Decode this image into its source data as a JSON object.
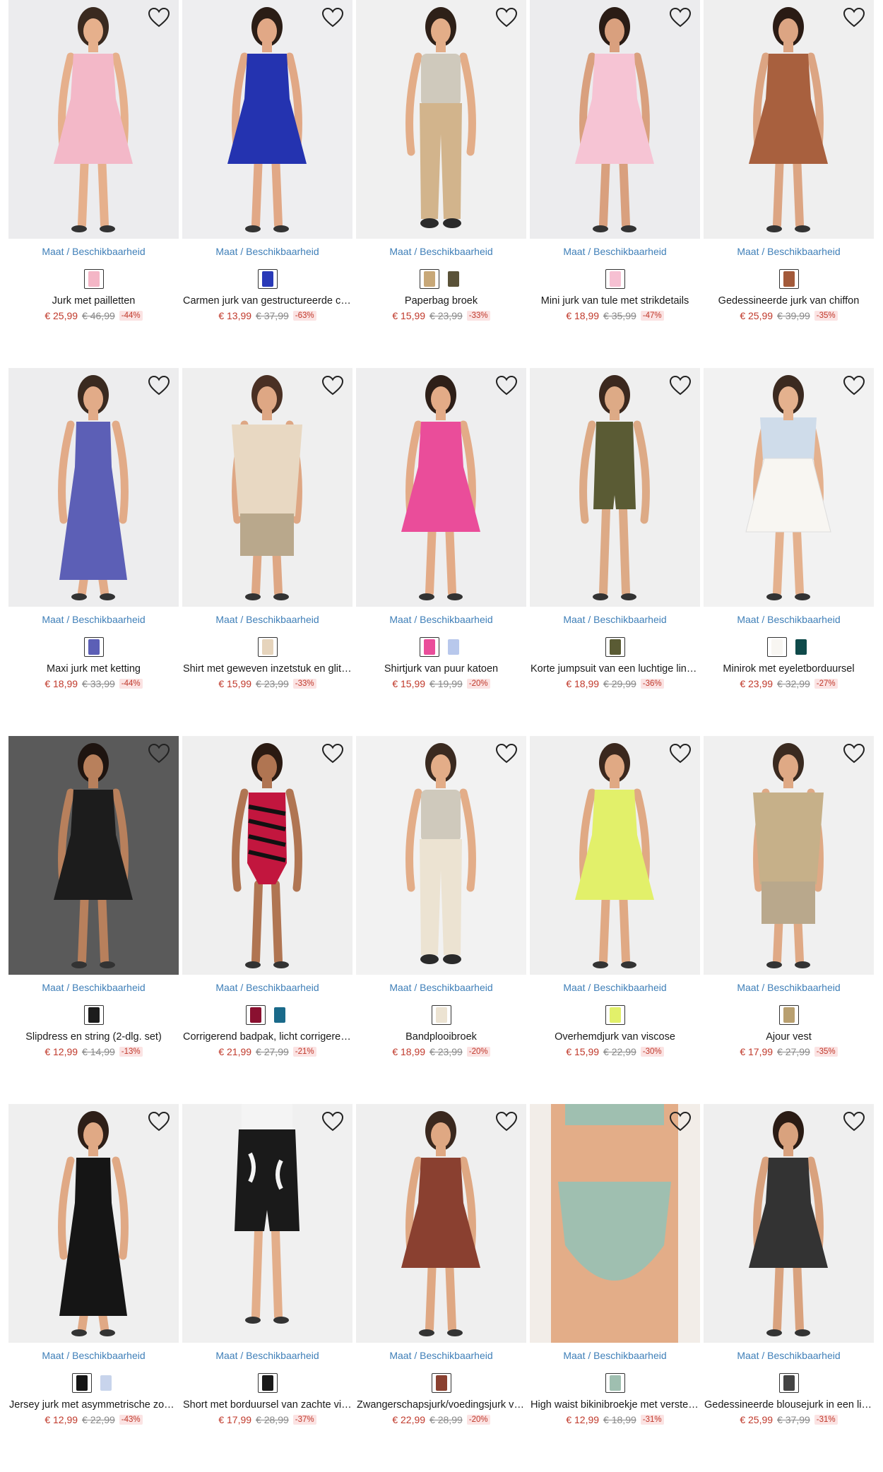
{
  "availability_label": "Maat / Beschikbaarheid",
  "products": [
    {
      "name": "Jurk met pailletten",
      "price": "€ 25,99",
      "old_price": "€ 46,99",
      "discount": "-44%",
      "bg": "#ececee",
      "garment": "#f3b8c8",
      "skin": "#e6b08c",
      "hair": "#3a2a20",
      "shape": "dress",
      "swatches": [
        "#f4b6c6"
      ]
    },
    {
      "name": "Carmen jurk van gestructureerde crêpe",
      "price": "€ 13,99",
      "old_price": "€ 37,99",
      "discount": "-63%",
      "bg": "#eeeef0",
      "garment": "#2433b0",
      "skin": "#e1a886",
      "hair": "#2b1d16",
      "shape": "dress",
      "swatches": [
        "#2a3ab8"
      ]
    },
    {
      "name": "Paperbag broek",
      "price": "€ 15,99",
      "old_price": "€ 23,99",
      "discount": "-33%",
      "bg": "#f0f0f0",
      "garment": "#d2b48c",
      "skin": "#e3ad88",
      "hair": "#2e2018",
      "shape": "pants",
      "swatches": [
        "#c8a878",
        "#5a5238"
      ]
    },
    {
      "name": "Mini jurk van tule met strikdetails",
      "price": "€ 18,99",
      "old_price": "€ 35,99",
      "discount": "-47%",
      "bg": "#ececee",
      "garment": "#f6c4d4",
      "skin": "#d9a07e",
      "hair": "#2a1c15",
      "shape": "dress",
      "swatches": [
        "#f6c0d2"
      ]
    },
    {
      "name": "Gedessineerde jurk van chiffon",
      "price": "€ 25,99",
      "old_price": "€ 39,99",
      "discount": "-35%",
      "bg": "#efefef",
      "garment": "#a8603e",
      "skin": "#dca583",
      "hair": "#2a1b14",
      "shape": "dress",
      "swatches": [
        "#a35a3a"
      ]
    },
    {
      "name": "Maxi jurk met ketting",
      "price": "€ 18,99",
      "old_price": "€ 33,99",
      "discount": "-44%",
      "bg": "#ededee",
      "garment": "#5c5fb6",
      "skin": "#e2ab88",
      "hair": "#3a2a20",
      "shape": "maxi",
      "swatches": [
        "#5c5fb6"
      ]
    },
    {
      "name": "Shirt met geweven inzetstuk en glitter",
      "price": "€ 15,99",
      "old_price": "€ 23,99",
      "discount": "-33%",
      "bg": "#efefef",
      "garment": "#e8d8c2",
      "skin": "#dea784",
      "hair": "#4a3024",
      "shape": "top",
      "swatches": [
        "#e6d4bc"
      ]
    },
    {
      "name": "Shirtjurk van puur katoen",
      "price": "€ 15,99",
      "old_price": "€ 19,99",
      "discount": "-20%",
      "bg": "#eeeeef",
      "garment": "#ea4d9a",
      "skin": "#e3ab87",
      "hair": "#2e1f18",
      "shape": "dress",
      "swatches": [
        "#ea4d9a",
        "#b8c8ec"
      ]
    },
    {
      "name": "Korte jumpsuit van een luchtige linnenmix",
      "price": "€ 18,99",
      "old_price": "€ 29,99",
      "discount": "-36%",
      "bg": "#efefef",
      "garment": "#5a5b34",
      "skin": "#ddaa86",
      "hair": "#3b281e",
      "shape": "short",
      "swatches": [
        "#5a5b34"
      ]
    },
    {
      "name": "Minirok met eyeletborduursel",
      "price": "€ 23,99",
      "old_price": "€ 32,99",
      "discount": "-27%",
      "bg": "#f2f2f2",
      "garment": "#f8f6f2",
      "skin": "#e4b18e",
      "hair": "#3b2a20",
      "shape": "skirt",
      "swatches": [
        "#f8f6f2",
        "#0f4a4a"
      ]
    },
    {
      "name": "Slipdress en string (2-dlg. set)",
      "price": "€ 12,99",
      "old_price": "€ 14,99",
      "discount": "-13%",
      "bg": "#5a5a5a",
      "garment": "#1c1c1c",
      "skin": "#b8805c",
      "hair": "#1e1410",
      "shape": "dress",
      "swatches": [
        "#1c1c1c"
      ]
    },
    {
      "name": "Corrigerend badpak, licht corrigerend",
      "price": "€ 21,99",
      "old_price": "€ 27,99",
      "discount": "-21%",
      "bg": "#efefef",
      "garment": "#c2163e",
      "skin": "#b07552",
      "hair": "#2a1a12",
      "shape": "swim",
      "swatches": [
        "#8a1030",
        "#1a6a8a"
      ]
    },
    {
      "name": "Bandplooibroek",
      "price": "€ 18,99",
      "old_price": "€ 23,99",
      "discount": "-20%",
      "bg": "#f2f2f2",
      "garment": "#ece3d2",
      "skin": "#e3ad88",
      "hair": "#3a2a20",
      "shape": "pants",
      "swatches": [
        "#ece3d2"
      ]
    },
    {
      "name": "Overhemdjurk van viscose",
      "price": "€ 15,99",
      "old_price": "€ 22,99",
      "discount": "-30%",
      "bg": "#efefef",
      "garment": "#e2f06a",
      "skin": "#e0a984",
      "hair": "#3b281e",
      "shape": "dress",
      "swatches": [
        "#e2f06a"
      ]
    },
    {
      "name": "Ajour vest",
      "price": "€ 17,99",
      "old_price": "€ 27,99",
      "discount": "-35%",
      "bg": "#f0f0f0",
      "garment": "#c6b089",
      "skin": "#dfa985",
      "hair": "#3a2a20",
      "shape": "top",
      "swatches": [
        "#b9a070"
      ]
    },
    {
      "name": "Jersey jurk met asymmetrische zoom",
      "price": "€ 12,99",
      "old_price": "€ 22,99",
      "discount": "-43%",
      "bg": "#efefef",
      "garment": "#151515",
      "skin": "#e0a985",
      "hair": "#2e1f18",
      "shape": "maxi",
      "swatches": [
        "#151515",
        "#c8d4ec"
      ]
    },
    {
      "name": "Short met borduursel van zachte viscose",
      "price": "€ 17,99",
      "old_price": "€ 28,99",
      "discount": "-37%",
      "bg": "#f0f0f0",
      "garment": "#1a1a1a",
      "skin": "#e3ae8a",
      "hair": "#3a2a20",
      "shape": "shorts",
      "swatches": [
        "#1a1a1a"
      ]
    },
    {
      "name": "Zwangerschapsjurk/voedingsjurk van viscose",
      "price": "€ 22,99",
      "old_price": "€ 28,99",
      "discount": "-20%",
      "bg": "#efefef",
      "garment": "#8a4030",
      "skin": "#dfa883",
      "hair": "#3a281e",
      "shape": "dress",
      "swatches": [
        "#8a4030"
      ]
    },
    {
      "name": "High waist bikinibroekje met verstevigend effect",
      "price": "€ 12,99",
      "old_price": "€ 18,99",
      "discount": "-31%",
      "bg": "#f2ede8",
      "garment": "#9fbfb0",
      "skin": "#e3ad88",
      "hair": "#3a2a20",
      "shape": "bikini",
      "swatches": [
        "#9fbfb0"
      ]
    },
    {
      "name": "Gedessineerde blousejurk in een lichte kwaliteit",
      "price": "€ 25,99",
      "old_price": "€ 37,99",
      "discount": "-31%",
      "bg": "#efefef",
      "garment": "#333333",
      "skin": "#d9a27e",
      "hair": "#2a1b14",
      "shape": "dress",
      "swatches": [
        "#444444"
      ]
    }
  ]
}
